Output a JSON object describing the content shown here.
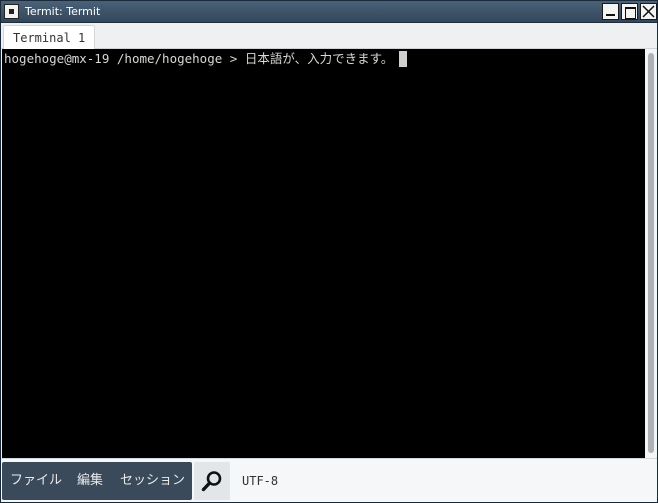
{
  "window": {
    "title": "Termit: Termit"
  },
  "tabs": [
    {
      "label": "Terminal 1",
      "active": true
    }
  ],
  "terminal": {
    "prompt_user_host": "hogehoge@mx-19",
    "prompt_path": "/home/hogehoge",
    "prompt_symbol": ">",
    "input_text": "日本語が、入力できます。",
    "background_color": "#000000",
    "foreground_color": "#d8d8d8"
  },
  "statusbar": {
    "menus": {
      "file": "ファイル",
      "edit": "編集",
      "session": "セッション"
    },
    "encoding": "UTF-8"
  },
  "icons": {
    "window_menu": "window-menu-icon",
    "minimize": "minimize-icon",
    "maximize": "maximize-icon",
    "close": "close-icon",
    "search": "search-icon"
  },
  "colors": {
    "titlebar": "#3d5266",
    "menubar": "#3a4a5a"
  }
}
